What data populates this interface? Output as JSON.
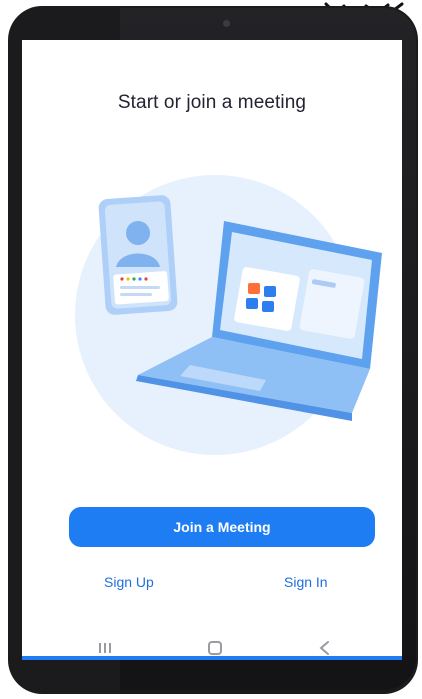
{
  "screen": {
    "title": "Start or join a meeting",
    "join_button_label": "Join a Meeting",
    "sign_up_label": "Sign Up",
    "sign_in_label": "Sign In"
  },
  "navigation_bar": {
    "buttons": [
      "recent-apps",
      "home",
      "back"
    ]
  },
  "colors": {
    "accent": "#1f7df3",
    "link": "#1f6fe0",
    "title_text": "#232333",
    "illustration_bg": "#e6f1fd",
    "device_frame": "#1b1b1d"
  },
  "icons": {
    "illustration": "meeting-illustration-icon",
    "recent_apps": "recent-apps-icon",
    "home": "home-icon",
    "back": "back-icon"
  }
}
